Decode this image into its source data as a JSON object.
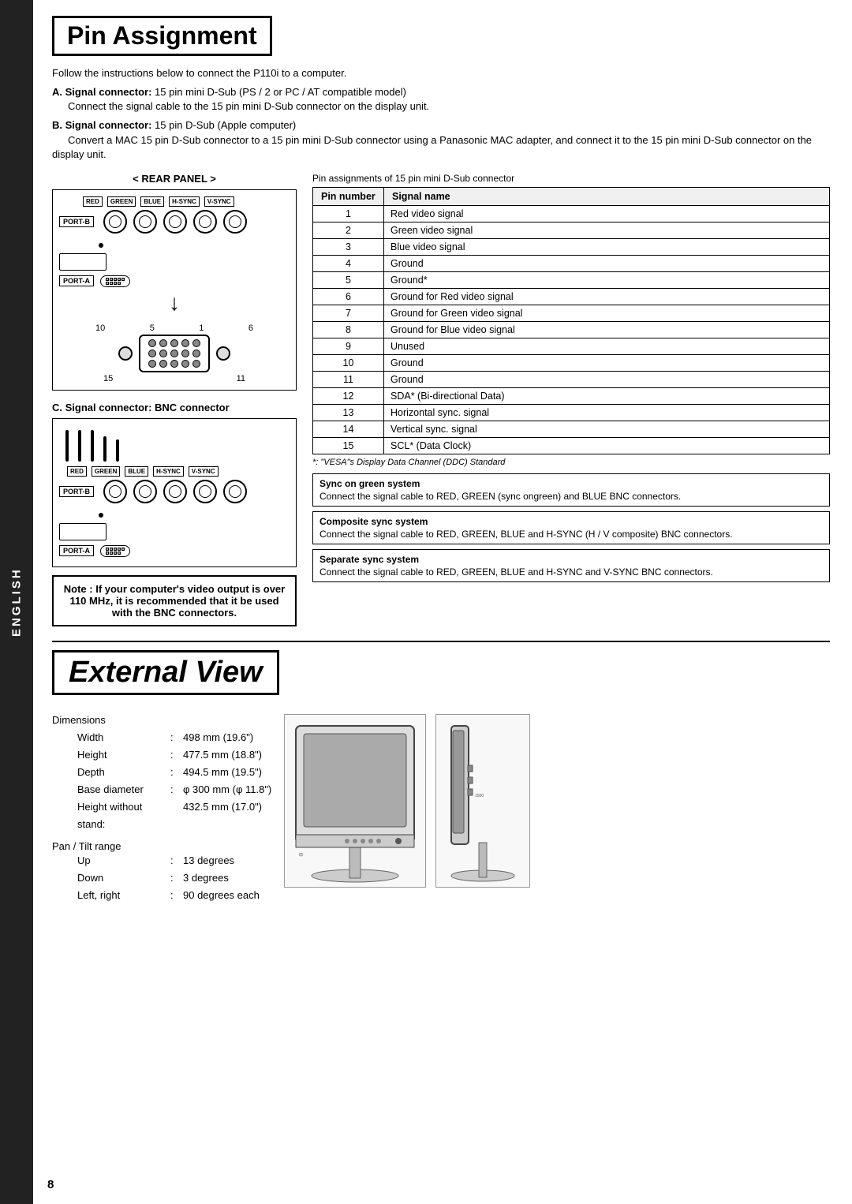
{
  "side_tab": {
    "text": "ENGLISH"
  },
  "page_number": "8",
  "pin_assignment": {
    "section_title": "Pin Assignment",
    "intro": "Follow the instructions below to connect the P110i to a computer.",
    "signal_a_label": "A. Signal connector:",
    "signal_a_desc": "15 pin mini D-Sub (PS / 2 or PC / AT compatible model)",
    "signal_a_detail": "Connect the signal cable to the 15 pin mini D-Sub connector on the display unit.",
    "signal_b_label": "B. Signal connector:",
    "signal_b_desc": "15 pin D-Sub (Apple computer)",
    "signal_b_detail": "Convert a MAC 15 pin D-Sub connector to a 15 pin mini D-Sub connector using a Panasonic MAC adapter, and connect it to the 15 pin mini D-Sub connector on the display unit.",
    "rear_panel_label": "< REAR PANEL >",
    "pin_assignments_label": "Pin assignments of 15 pin mini D-Sub connector",
    "connector_labels": [
      "RED",
      "GREEN",
      "BLUE",
      "H-SYNC",
      "V-SYNC"
    ],
    "port_b": "PORT-B",
    "port_a": "PORT-A",
    "dsub_numbers": {
      "top_left": "10",
      "top_mid1": "5",
      "top_mid2": "1",
      "top_right": "6",
      "bottom_left": "15",
      "bottom_right": "11"
    },
    "pin_table_headers": [
      "Pin number",
      "Signal name"
    ],
    "pin_table_rows": [
      [
        "1",
        "Red video signal"
      ],
      [
        "2",
        "Green video signal"
      ],
      [
        "3",
        "Blue video signal"
      ],
      [
        "4",
        "Ground"
      ],
      [
        "5",
        "Ground*"
      ],
      [
        "6",
        "Ground  for  Red video signal"
      ],
      [
        "7",
        "Ground  for  Green video signal"
      ],
      [
        "8",
        "Ground  for  Blue video signal"
      ],
      [
        "9",
        "Unused"
      ],
      [
        "10",
        "Ground"
      ],
      [
        "11",
        "Ground"
      ],
      [
        "12",
        "SDA* (Bi-directional Data)"
      ],
      [
        "13",
        "Horizontal sync. signal"
      ],
      [
        "14",
        "Vertical sync. signal"
      ],
      [
        "15",
        "SCL* (Data Clock)"
      ]
    ],
    "vesa_note": "*: \"VESA\"s Display Data Channel (DDC) Standard",
    "sync_boxes": [
      {
        "title": "Sync on green system",
        "desc": "Connect the signal cable to RED, GREEN (sync ongreen) and BLUE BNC connectors."
      },
      {
        "title": "Composite sync system",
        "desc": "Connect the signal cable to RED, GREEN, BLUE and H-SYNC (H / V composite) BNC connectors."
      },
      {
        "title": "Separate sync system",
        "desc": "Connect the signal cable to RED, GREEN, BLUE and H-SYNC and V-SYNC BNC connectors."
      }
    ],
    "signal_c_label": "C. Signal connector:",
    "signal_c_desc": "BNC connector",
    "bnc_note": "Note : If your computer's video output is over 110 MHz, it is recommended that it be used with the BNC connectors."
  },
  "external_view": {
    "section_title": "External View",
    "dimensions_title": "Dimensions",
    "dim_rows": [
      {
        "label": "Width",
        "colon": ":",
        "value": "498 mm (19.6\")"
      },
      {
        "label": "Height",
        "colon": ":",
        "value": "477.5 mm (18.8\")"
      },
      {
        "label": "Depth",
        "colon": ":",
        "value": "494.5 mm (19.5\")"
      },
      {
        "label": "Base diameter",
        "colon": ":",
        "value": "φ 300 mm (φ 11.8\")"
      },
      {
        "label": "Height without stand:",
        "colon": "",
        "value": "432.5 mm (17.0\")"
      }
    ],
    "pan_tilt_title": "Pan / Tilt range",
    "pan_tilt_rows": [
      {
        "label": "Up",
        "colon": ":",
        "value": "13 degrees"
      },
      {
        "label": "Down",
        "colon": ":",
        "value": "3 degrees"
      },
      {
        "label": "Left, right",
        "colon": ":",
        "value": "90 degrees each"
      }
    ]
  }
}
